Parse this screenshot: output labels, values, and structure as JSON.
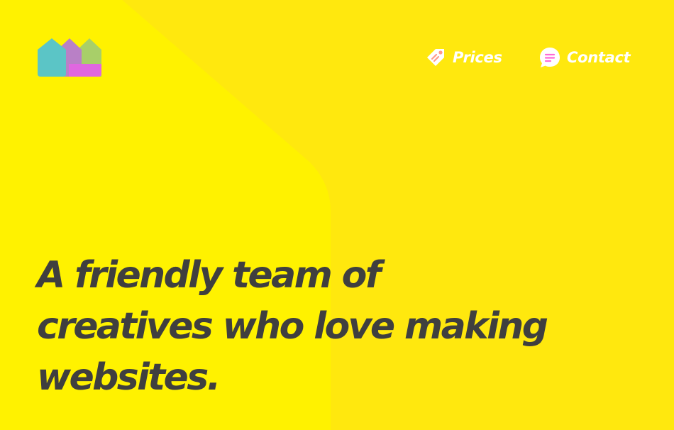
{
  "brand": {
    "logo_icon": "houses-logo-icon",
    "colors": [
      "#5bc5c6",
      "#b980c6",
      "#a8cf69",
      "#e067e0"
    ]
  },
  "background": {
    "from_color": "#fff200",
    "to_color": "#ff55e2"
  },
  "nav": {
    "prices": {
      "label": "Prices",
      "icon": "price-tag-icon"
    },
    "contact": {
      "label": "Contact",
      "icon": "chat-bubble-icon"
    }
  },
  "hero": {
    "lines": [
      "A friendly team of",
      "creatives who love making",
      "websites."
    ],
    "text_color": "#3f3f3f"
  }
}
